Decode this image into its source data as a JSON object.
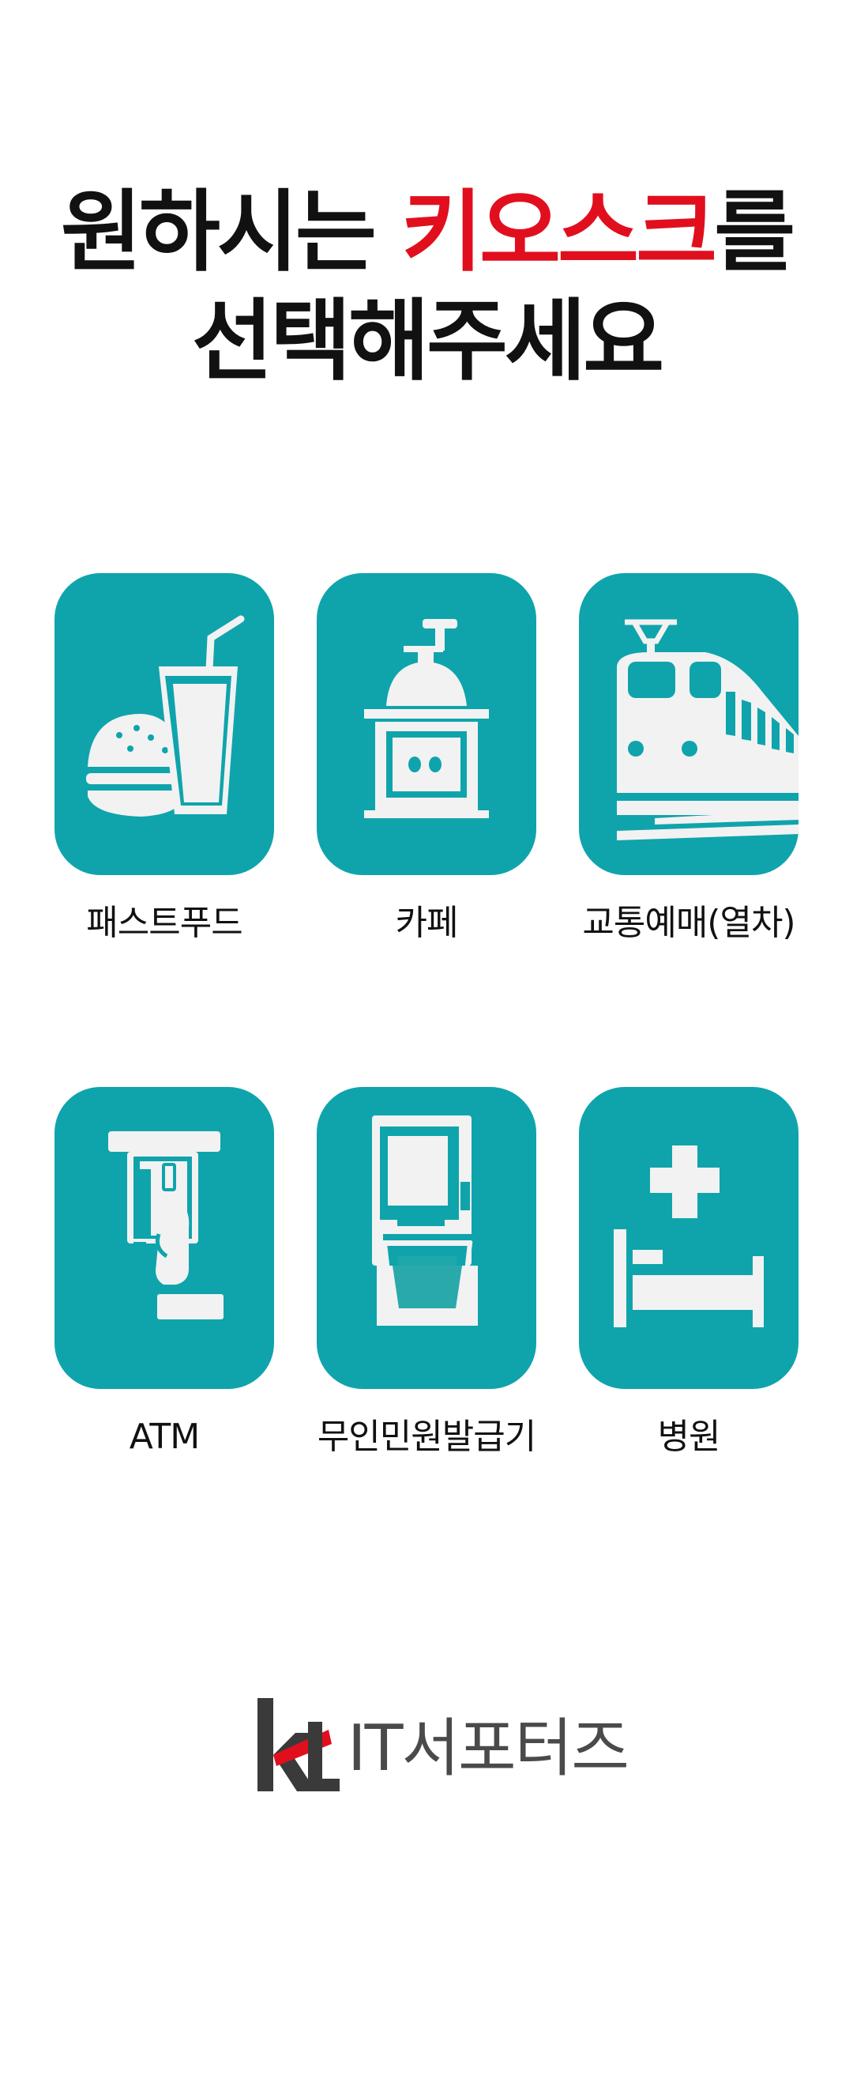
{
  "heading": {
    "line1_prefix": "원하시는 ",
    "line1_accent": "키오스크",
    "line1_suffix": "를",
    "line2": "선택해주세요",
    "accent_color": "#e10f1e"
  },
  "kiosks": [
    {
      "label": "패스트푸드",
      "icon": "burger-drink-icon"
    },
    {
      "label": "카페",
      "icon": "coffee-grinder-icon"
    },
    {
      "label": "교통예매(열차)",
      "icon": "train-icon"
    },
    {
      "label": "ATM",
      "icon": "atm-card-icon"
    },
    {
      "label": "무인민원발급기",
      "icon": "civil-kiosk-icon"
    },
    {
      "label": "병원",
      "icon": "hospital-bed-icon"
    }
  ],
  "tile_color": "#0fa4ac",
  "footer": {
    "logo_mark": "kt",
    "logo_text": "IT서포터즈"
  }
}
